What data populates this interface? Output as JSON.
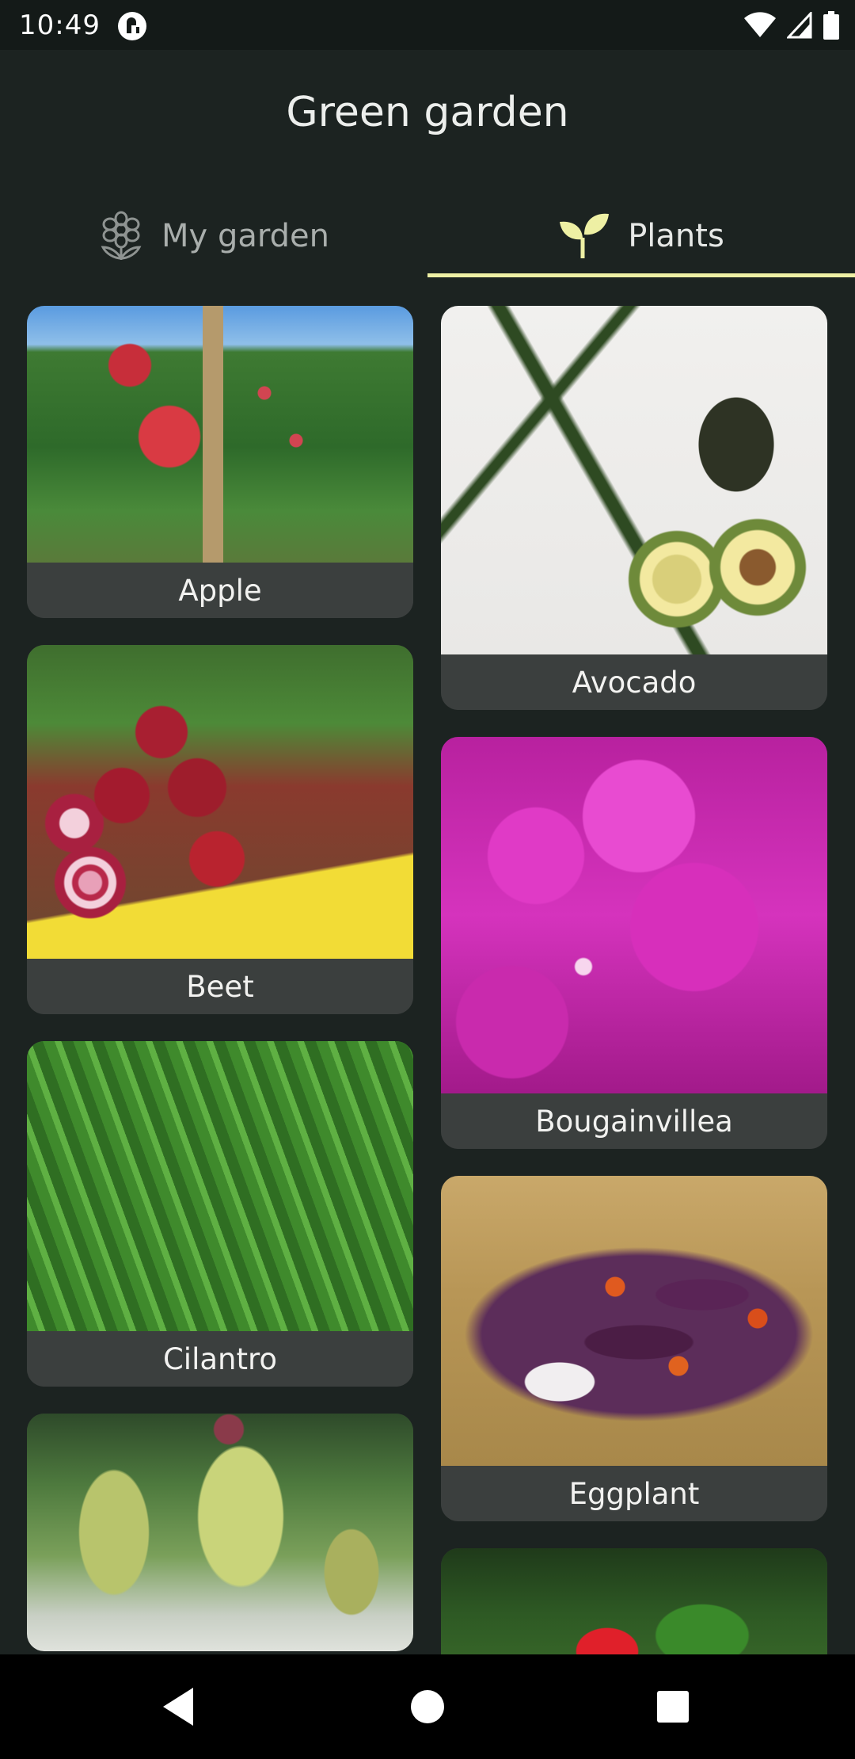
{
  "status_bar": {
    "time": "10:49"
  },
  "app": {
    "title": "Green garden"
  },
  "tabs": [
    {
      "label": "My garden",
      "icon": "flower-icon",
      "selected": false
    },
    {
      "label": "Plants",
      "icon": "sprout-icon",
      "selected": true
    }
  ],
  "plants": {
    "left": [
      {
        "name": "Apple"
      },
      {
        "name": "Beet"
      },
      {
        "name": "Cilantro"
      },
      {
        "name": ""
      }
    ],
    "right": [
      {
        "name": "Avocado"
      },
      {
        "name": "Bougainvillea"
      },
      {
        "name": "Eggplant"
      },
      {
        "name": ""
      }
    ]
  },
  "colors": {
    "background": "#1c2321",
    "tab_indicator": "#eef0a4",
    "card_label_bg": "#3b3f3e"
  }
}
